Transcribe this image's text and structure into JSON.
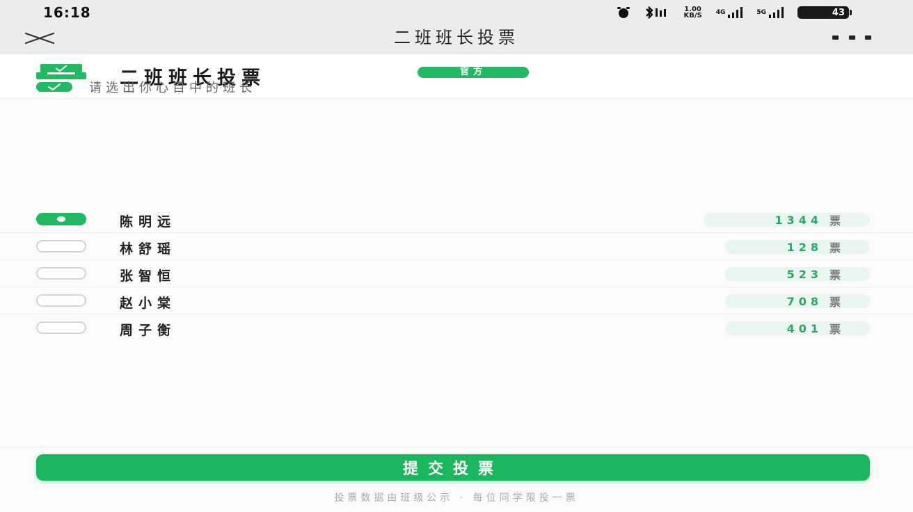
{
  "status_bar": {
    "time": "16:18",
    "net_speed_value": "1.00",
    "net_speed_unit": "KB/S",
    "signal_1_label": "4G",
    "signal_2_label": "5G",
    "battery": "43"
  },
  "nav": {
    "title": "二班班长投票",
    "close_icon": "close-icon",
    "more_icon": "more-icon"
  },
  "header": {
    "title": "二班班长投票",
    "badge": "官方",
    "subtitle": "请选出你心目中的班长",
    "accent_color": "#1fba62"
  },
  "candidates": [
    {
      "name": "陈明远",
      "votes": "1344",
      "unit": "票",
      "selected": true
    },
    {
      "name": "林舒瑶",
      "votes": "128",
      "unit": "票",
      "selected": false
    },
    {
      "name": "张智恒",
      "votes": "523",
      "unit": "票",
      "selected": false
    },
    {
      "name": "赵小棠",
      "votes": "708",
      "unit": "票",
      "selected": false
    },
    {
      "name": "周子衡",
      "votes": "401",
      "unit": "票",
      "selected": false
    }
  ],
  "footer": {
    "submit_label": "提交投票",
    "note": "投票数据由班级公示 · 每位同学限投一票"
  }
}
